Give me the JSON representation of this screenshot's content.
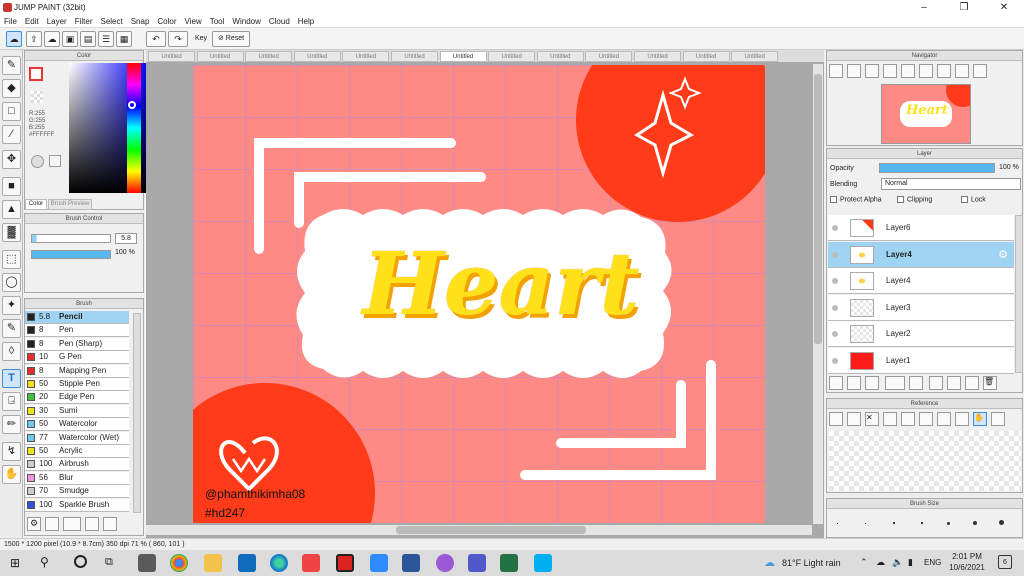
{
  "window": {
    "title": "JUMP PAINT (32bit)"
  },
  "menu": [
    "File",
    "Edit",
    "Layer",
    "Filter",
    "Select",
    "Snap",
    "Color",
    "View",
    "Tool",
    "Window",
    "Cloud",
    "Help"
  ],
  "toolbar": {
    "key_label": "Key",
    "reset_label": "Reset"
  },
  "color_panel": {
    "title": "Color",
    "r": "R:255",
    "g": "G:255",
    "b": "B:255",
    "hex": "#FFFFFF",
    "tab_color": "Color",
    "tab_preview": "Brush Preview"
  },
  "brush_control": {
    "title": "Brush Control",
    "size": "5.8",
    "opacity": "100 %"
  },
  "brush_panel": {
    "title": "Brush",
    "items": [
      {
        "size": "5.8",
        "name": "Pencil",
        "color": "#222222",
        "selected": true
      },
      {
        "size": "8",
        "name": "Pen",
        "color": "#222222"
      },
      {
        "size": "8",
        "name": "Pen (Sharp)",
        "color": "#222222"
      },
      {
        "size": "10",
        "name": "G Pen",
        "color": "#e03030"
      },
      {
        "size": "8",
        "name": "Mapping Pen",
        "color": "#e03030"
      },
      {
        "size": "50",
        "name": "Stipple Pen",
        "color": "#f0e020"
      },
      {
        "size": "20",
        "name": "Edge Pen",
        "color": "#40c040"
      },
      {
        "size": "30",
        "name": "Sumi",
        "color": "#f0e020"
      },
      {
        "size": "50",
        "name": "Watercolor",
        "color": "#70c8f0"
      },
      {
        "size": "77",
        "name": "Watercolor (Wet)",
        "color": "#70c8f0"
      },
      {
        "size": "50",
        "name": "Acrylic",
        "color": "#f0e020"
      },
      {
        "size": "100",
        "name": "Airbrush",
        "color": "#cccccc"
      },
      {
        "size": "56",
        "name": "Blur",
        "color": "#f090e0"
      },
      {
        "size": "70",
        "name": "Smudge",
        "color": "#cccccc"
      },
      {
        "size": "100",
        "name": "Sparkle Brush",
        "color": "#3050e0"
      }
    ]
  },
  "tabs": [
    "Untitled",
    "Untitled",
    "Untitled",
    "Untitled",
    "Untitled",
    "Untitled",
    "Untitled",
    "Untitled",
    "Untitled",
    "Untitled",
    "Untitled",
    "Untitled",
    "Untitled"
  ],
  "artwork": {
    "headline": "Heart",
    "credit": "@phamthikimha08",
    "tag": "#hd247",
    "bg": "#fd8a85",
    "accent": "#ff3b1a",
    "text_color": "#ffe11a"
  },
  "navigator": {
    "title": "Navigator"
  },
  "layer_panel": {
    "title": "Layer",
    "opacity_label": "Opacity",
    "opacity_value": "100 %",
    "blending_label": "Blending",
    "blending_value": "Normal",
    "protect_alpha": "Protect Alpha",
    "clipping": "Clipping",
    "lock": "Lock",
    "layers": [
      {
        "name": "Layer6"
      },
      {
        "name": "Layer4",
        "selected": true
      },
      {
        "name": "Layer4"
      },
      {
        "name": "Layer3"
      },
      {
        "name": "Layer2"
      },
      {
        "name": "Layer1"
      }
    ]
  },
  "reference": {
    "title": "Reference"
  },
  "brush_size": {
    "title": "Brush Size"
  },
  "status": {
    "text": "1500 * 1200 pixel  (10.9 * 8.7cm)  350 dpi  71 %  ( 860, 101 )"
  },
  "taskbar": {
    "weather": "81°F  Light rain",
    "lang": "ENG",
    "time": "2:01 PM",
    "date": "10/6/2021",
    "notif": "6"
  }
}
